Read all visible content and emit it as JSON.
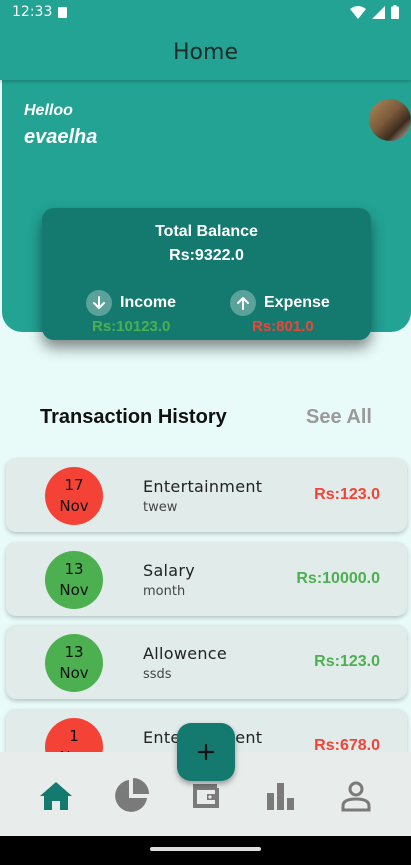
{
  "status_bar": {
    "time": "12:33"
  },
  "app_bar": {
    "title": "Home"
  },
  "header": {
    "greeting": "Helloo",
    "username": "evaelha"
  },
  "balance_card": {
    "title": "Total Balance",
    "total": "Rs:9322.0",
    "income_label": "Income",
    "income_value": "Rs:10123.0",
    "expense_label": "Expense",
    "expense_value": "Rs:801.0"
  },
  "history": {
    "title": "Transaction History",
    "see_all": "See All",
    "items": [
      {
        "day": "17",
        "month": "Nov",
        "name": "Entertainment",
        "desc": "twew",
        "amount": "Rs:123.0",
        "type": "expense"
      },
      {
        "day": "13",
        "month": "Nov",
        "name": "Salary",
        "desc": "month",
        "amount": "Rs:10000.0",
        "type": "income"
      },
      {
        "day": "13",
        "month": "Nov",
        "name": "Allowence",
        "desc": "ssds",
        "amount": "Rs:123.0",
        "type": "income"
      },
      {
        "day": "1",
        "month": "Nov",
        "name": "Entertainment",
        "desc": "",
        "amount": "Rs:678.0",
        "type": "expense"
      }
    ]
  },
  "fab": {
    "icon": "plus-icon"
  },
  "bottom_nav": {
    "items": [
      {
        "icon": "home-icon",
        "active": true
      },
      {
        "icon": "pie-chart-icon",
        "active": false
      },
      {
        "icon": "wallet-icon",
        "active": false
      },
      {
        "icon": "bar-chart-icon",
        "active": false
      },
      {
        "icon": "profile-icon",
        "active": false
      }
    ]
  },
  "colors": {
    "primary": "#22a394",
    "card": "#147a6f",
    "income": "#4caf50",
    "expense": "#f44336",
    "nav_active": "#147a6f",
    "nav_inactive": "#7a7a7a"
  }
}
